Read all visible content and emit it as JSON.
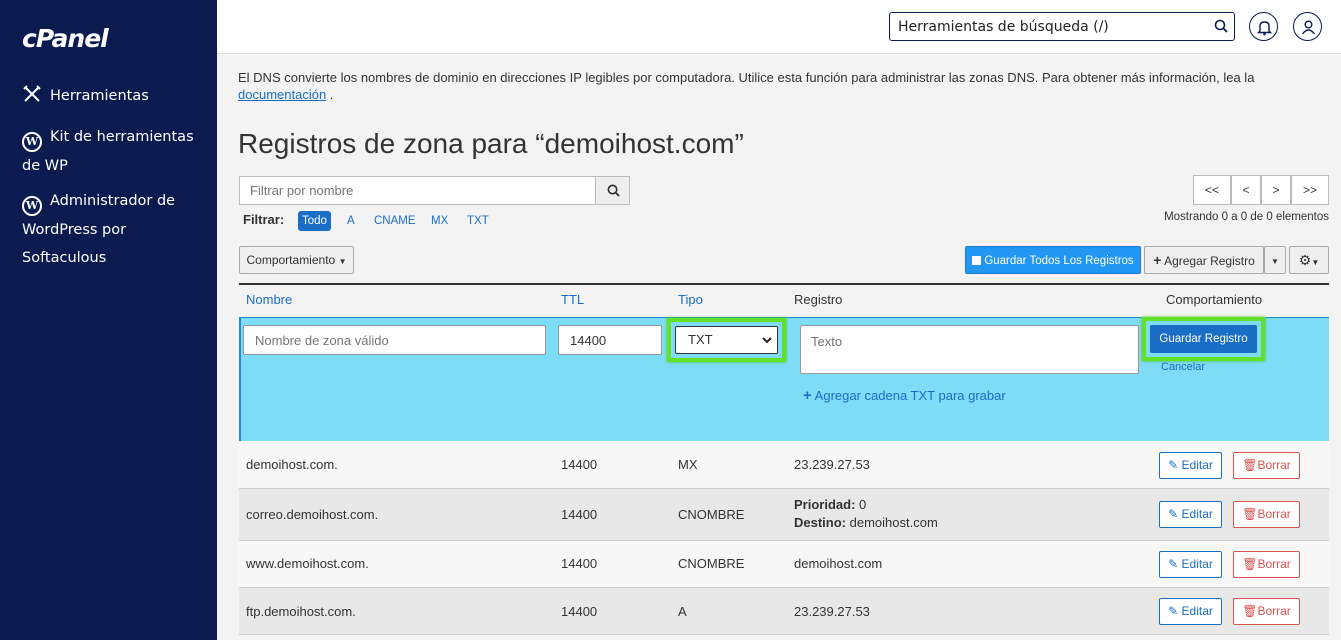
{
  "sidebar": {
    "logo": "cPanel",
    "items": [
      {
        "label": "Herramientas",
        "icon": "tools-icon"
      },
      {
        "label": "Kit de herramientas de WP",
        "icon": "wordpress-icon"
      },
      {
        "label": "Administrador de WordPress por Softaculous",
        "icon": "wordpress-icon"
      }
    ]
  },
  "topbar": {
    "search_placeholder": "Herramientas de búsqueda (/)"
  },
  "intro": {
    "text": "El DNS convierte los nombres de dominio en direcciones IP legibles por computadora. Utilice esta función para administrar las zonas DNS. Para obtener más información, lea la",
    "link": "documentación",
    "after": " ."
  },
  "page": {
    "title": "Registros de zona para “demoihost.com”"
  },
  "filter": {
    "placeholder": "Filtrar por nombre",
    "label": "Filtrar:",
    "chips": [
      "Todo",
      "A",
      "CNAME",
      "MX",
      "TXT"
    ],
    "active": "Todo"
  },
  "pager": {
    "first": "<<",
    "prev": "<",
    "next": ">",
    "last": ">>",
    "showing": "Mostrando 0 a 0 de 0 elementos"
  },
  "toolbar": {
    "behavior": "Comportamiento",
    "save_all": "Guardar Todos Los Registros",
    "add_record": "Agregar Registro"
  },
  "table": {
    "headers": {
      "name": "Nombre",
      "ttl": "TTL",
      "type": "Tipo",
      "record": "Registro",
      "actions": "Comportamiento"
    },
    "new_row": {
      "name_placeholder": "Nombre de zona válido",
      "ttl": "14400",
      "type": "TXT",
      "text_placeholder": "Texto",
      "add_txt": "Agregar cadena TXT para grabar",
      "save": "Guardar Registro",
      "cancel": "Cancelar"
    },
    "rows": [
      {
        "name": "demoihost.com.",
        "ttl": "14400",
        "type": "MX",
        "record": "23.239.27.53"
      },
      {
        "name": "correo.demoihost.com.",
        "ttl": "14400",
        "type": "CNOMBRE",
        "priority_label": "Prioridad:",
        "priority": "0",
        "dest_label": "Destino:",
        "dest": "demoihost.com"
      },
      {
        "name": "www.demoihost.com.",
        "ttl": "14400",
        "type": "CNOMBRE",
        "record": "demoihost.com"
      },
      {
        "name": "ftp.demoihost.com.",
        "ttl": "14400",
        "type": "A",
        "record": "23.239.27.53"
      }
    ],
    "edit_label": "Editar",
    "delete_label": "Borrar"
  },
  "colors": {
    "sidebar": "#0b1b4f",
    "primary": "#2196f3",
    "edit_row": "#7fdcf7",
    "highlight": "#62e02a",
    "danger": "#d9534f"
  }
}
